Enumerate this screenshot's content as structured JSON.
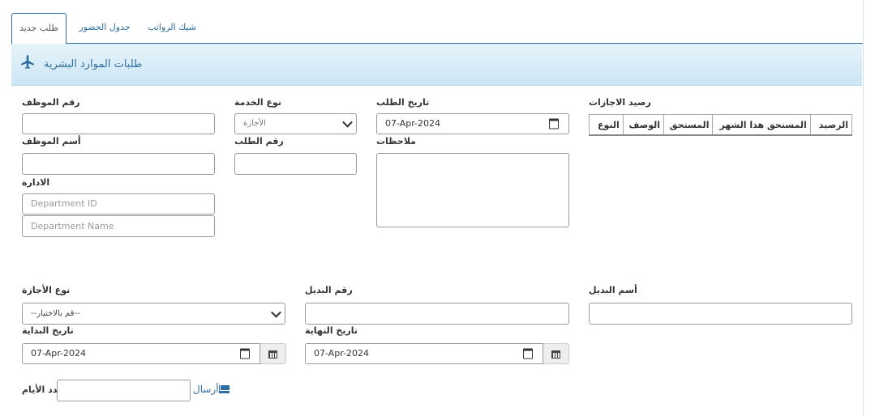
{
  "tabs": [
    "طلب جديد",
    "جدول الحضور",
    "شيك الرواتب"
  ],
  "banner": {
    "title": "طلبات الموارد البشرية"
  },
  "form": {
    "employee_no_label": "رقم الموظف",
    "employee_no_value": "",
    "service_type_label": "نوع الخدمة",
    "service_type_value": "الأجازة",
    "request_date_label": "تاريخ الطلب",
    "request_date_value": "07-Apr-2024",
    "employee_name_label": "أسم الموظف",
    "employee_name_value": "",
    "request_no_label": "رقم الطلب",
    "request_no_value": "",
    "notes_label": "ملاحظات",
    "notes_value": "",
    "department_label": "الادارة",
    "department_id_placeholder": "Department ID",
    "department_name_placeholder": "Department Name",
    "leave_type_label": "نوع الأجازة",
    "leave_type_value": "--قم بالاختيار--",
    "substitute_no_label": "رقم البديل",
    "substitute_no_value": "",
    "substitute_name_label": "أسم البديل",
    "substitute_name_value": "",
    "start_date_label": "تاريخ البداية",
    "start_date_value": "07-Apr-2024",
    "end_date_label": "تاريخ النهاية",
    "end_date_value": "07-Apr-2024",
    "days_label": "عدد الأيام",
    "days_value": "",
    "send_label": "أرسال"
  },
  "balance": {
    "title": "رصيد الاجازات",
    "columns": [
      "الرصيد",
      "المستحق هذا الشهر",
      "المستحق",
      "الوصف",
      "النوع"
    ]
  },
  "icons": {
    "banner": "airplane-icon",
    "send": "envelope-icon",
    "calendar": "calendar-icon",
    "dropdown": "chevron-down-icon"
  },
  "colors": {
    "link": "#2f6ea1",
    "banner_top": "#e7f3fa",
    "banner_bottom": "#cbe6f4"
  }
}
